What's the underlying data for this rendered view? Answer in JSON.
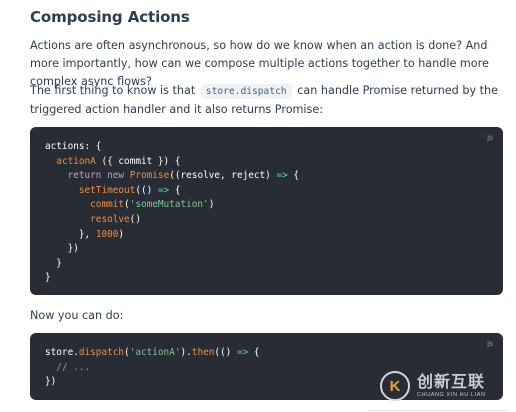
{
  "heading": "Composing Actions",
  "intro": "Actions are often asynchronous, so how do we know when an action is done? And more importantly, how can we compose multiple actions together to handle more complex async flows?",
  "para2": {
    "before": "The first thing to know is that",
    "code": "store.dispatch",
    "after": "can handle Promise returned by the triggered action handler and it also returns Promise:"
  },
  "code_block_1": {
    "lang": "js",
    "lines": [
      "actions: {",
      "  actionA ({ commit }) {",
      "    return new Promise((resolve, reject) => {",
      "      setTimeout(() => {",
      "        commit('someMutation')",
      "        resolve()",
      "      }, 1000)",
      "    })",
      "  }",
      "}"
    ]
  },
  "para3": "Now you can do:",
  "code_block_2": {
    "lang": "js",
    "lines": [
      "store.dispatch('actionA').then(() => {",
      "  // ...",
      "})"
    ]
  },
  "watermark": {
    "logo_letter": "K",
    "chinese": "创新互联",
    "english": "CHUANG XIN HU LIAN"
  },
  "colors": {
    "text": "#2c3e50",
    "code_bg": "#282c34",
    "keyword": "#cc99cd",
    "function": "#f08d49",
    "string": "#7ec699",
    "operator": "#67cdcc",
    "comment": "#999999",
    "inline_code": "#476582"
  }
}
